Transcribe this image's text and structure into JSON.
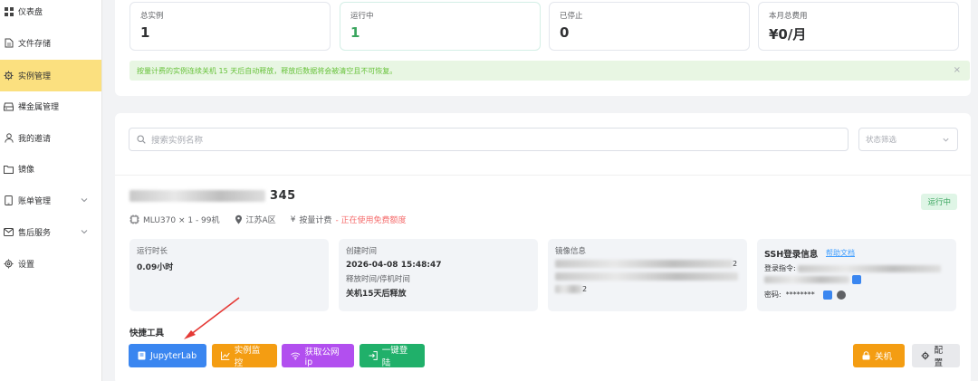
{
  "sidebar": {
    "items": [
      {
        "label": "仪表盘",
        "icon": "dashboard-icon"
      },
      {
        "label": "文件存储",
        "icon": "file-icon"
      },
      {
        "label": "实例管理",
        "icon": "gear-icon",
        "active": true
      },
      {
        "label": "裸金属管理",
        "icon": "server-icon"
      },
      {
        "label": "我的邀请",
        "icon": "user-icon"
      },
      {
        "label": "镜像",
        "icon": "folder-icon"
      },
      {
        "label": "账单管理",
        "icon": "phone-icon",
        "expandable": true
      },
      {
        "label": "售后服务",
        "icon": "mail-icon",
        "expandable": true
      },
      {
        "label": "设置",
        "icon": "settings-icon"
      }
    ]
  },
  "stats": [
    {
      "label": "总实例",
      "value": "1"
    },
    {
      "label": "运行中",
      "value": "1"
    },
    {
      "label": "已停止",
      "value": "0"
    },
    {
      "label": "本月总费用",
      "value": "¥0/月"
    }
  ],
  "alert": {
    "text": "按量计费的实例连续关机 15 天后自动释放，释放后数据将会被清空且不可恢复。",
    "close": "×"
  },
  "search": {
    "placeholder": "搜索实例名称"
  },
  "filter": {
    "placeholder": "状态筛选"
  },
  "instance": {
    "name_suffix": "345",
    "status": "运行中",
    "gpu": "MLU370 × 1 - 99机",
    "region": "江苏A区",
    "billing": "按量计费",
    "billing_note": "- 正在使用免费额度",
    "runtime": {
      "title": "运行时长",
      "value": "0.09小时"
    },
    "created": {
      "title": "创建时间",
      "value": "2026-04-08 15:48:47",
      "release_title": "释放时间/停机时间",
      "release_value": "关机15天后释放"
    },
    "image": {
      "title": "镜像信息",
      "tail1": "2",
      "tail2": "2"
    },
    "ssh": {
      "title": "SSH登录信息",
      "help": "帮助文档",
      "login_label": "登录指令:",
      "password_label": "密码:",
      "password_mask": "********"
    }
  },
  "tools": {
    "label": "快捷工具",
    "jupyter": "JupyterLab",
    "monitor": "实例监控",
    "public_ip": "获取公网ip",
    "one_click": "一键登陆",
    "shutdown": "关机",
    "config": "配置"
  },
  "colors": {
    "active_nav": "#fbe07f",
    "running_green": "#3aa55e",
    "alert_bg": "#e8f6e3",
    "blue": "#3a86f0",
    "orange": "#f49d12",
    "purple": "#b24fef",
    "green": "#20b06a",
    "arrow_red": "#e53935"
  }
}
